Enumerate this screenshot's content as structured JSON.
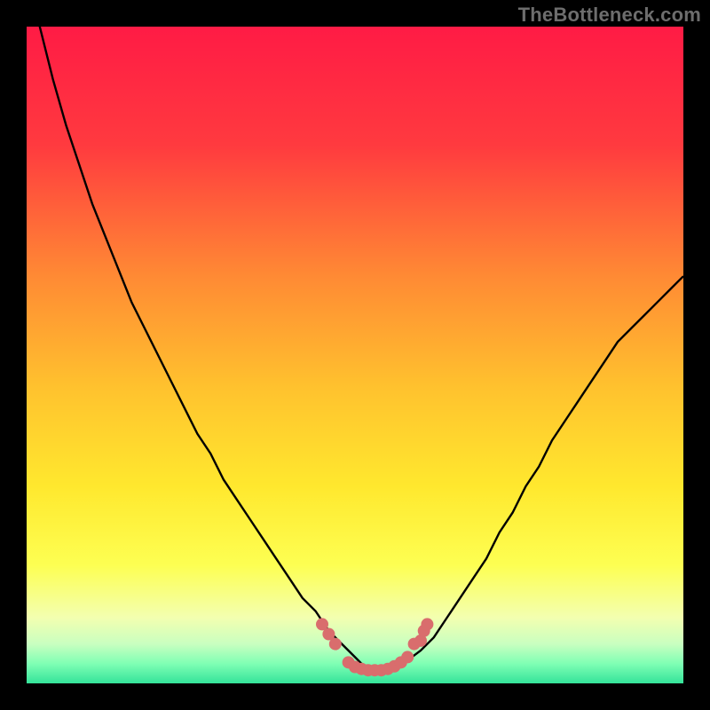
{
  "watermark": "TheBottleneck.com",
  "colors": {
    "background": "#000000",
    "gradient_top": "#ff1b45",
    "gradient_upper": "#ff7a3a",
    "gradient_mid": "#ffd62e",
    "gradient_lower": "#fbff66",
    "gradient_green_light": "#9bffb0",
    "gradient_green": "#34e39a",
    "curve": "#000000",
    "markers": "#d96d6d",
    "watermark_text": "#6d6d6d"
  },
  "chart_data": {
    "type": "line",
    "title": "",
    "xlabel": "",
    "ylabel": "",
    "xlim": [
      0,
      100
    ],
    "ylim": [
      0,
      100
    ],
    "series": [
      {
        "name": "bottleneck-curve",
        "x": [
          0,
          2,
          4,
          6,
          8,
          10,
          12,
          14,
          16,
          18,
          20,
          22,
          24,
          26,
          28,
          30,
          32,
          34,
          36,
          38,
          40,
          42,
          44,
          46,
          47,
          48,
          49,
          50,
          51,
          52,
          53,
          54,
          55,
          56,
          58,
          60,
          62,
          64,
          66,
          68,
          70,
          72,
          74,
          76,
          78,
          80,
          82,
          84,
          86,
          88,
          90,
          92,
          94,
          96,
          98,
          100
        ],
        "values": [
          110,
          100,
          92,
          85,
          79,
          73,
          68,
          63,
          58,
          54,
          50,
          46,
          42,
          38,
          35,
          31,
          28,
          25,
          22,
          19,
          16,
          13,
          11,
          8,
          7,
          6,
          5,
          4,
          3,
          2.5,
          2,
          2,
          2,
          2.5,
          3.5,
          5,
          7,
          10,
          13,
          16,
          19,
          23,
          26,
          30,
          33,
          37,
          40,
          43,
          46,
          49,
          52,
          54,
          56,
          58,
          60,
          62
        ]
      }
    ],
    "markers": [
      {
        "x": 45,
        "y": 9
      },
      {
        "x": 46,
        "y": 7.5
      },
      {
        "x": 47,
        "y": 6
      },
      {
        "x": 49,
        "y": 3.2
      },
      {
        "x": 50,
        "y": 2.5
      },
      {
        "x": 51,
        "y": 2.2
      },
      {
        "x": 52,
        "y": 2
      },
      {
        "x": 53,
        "y": 2
      },
      {
        "x": 54,
        "y": 2
      },
      {
        "x": 55,
        "y": 2.2
      },
      {
        "x": 56,
        "y": 2.6
      },
      {
        "x": 57,
        "y": 3.2
      },
      {
        "x": 58,
        "y": 4
      },
      {
        "x": 59,
        "y": 6
      },
      {
        "x": 60,
        "y": 6.5
      },
      {
        "x": 60.5,
        "y": 8
      },
      {
        "x": 61,
        "y": 9
      }
    ]
  }
}
